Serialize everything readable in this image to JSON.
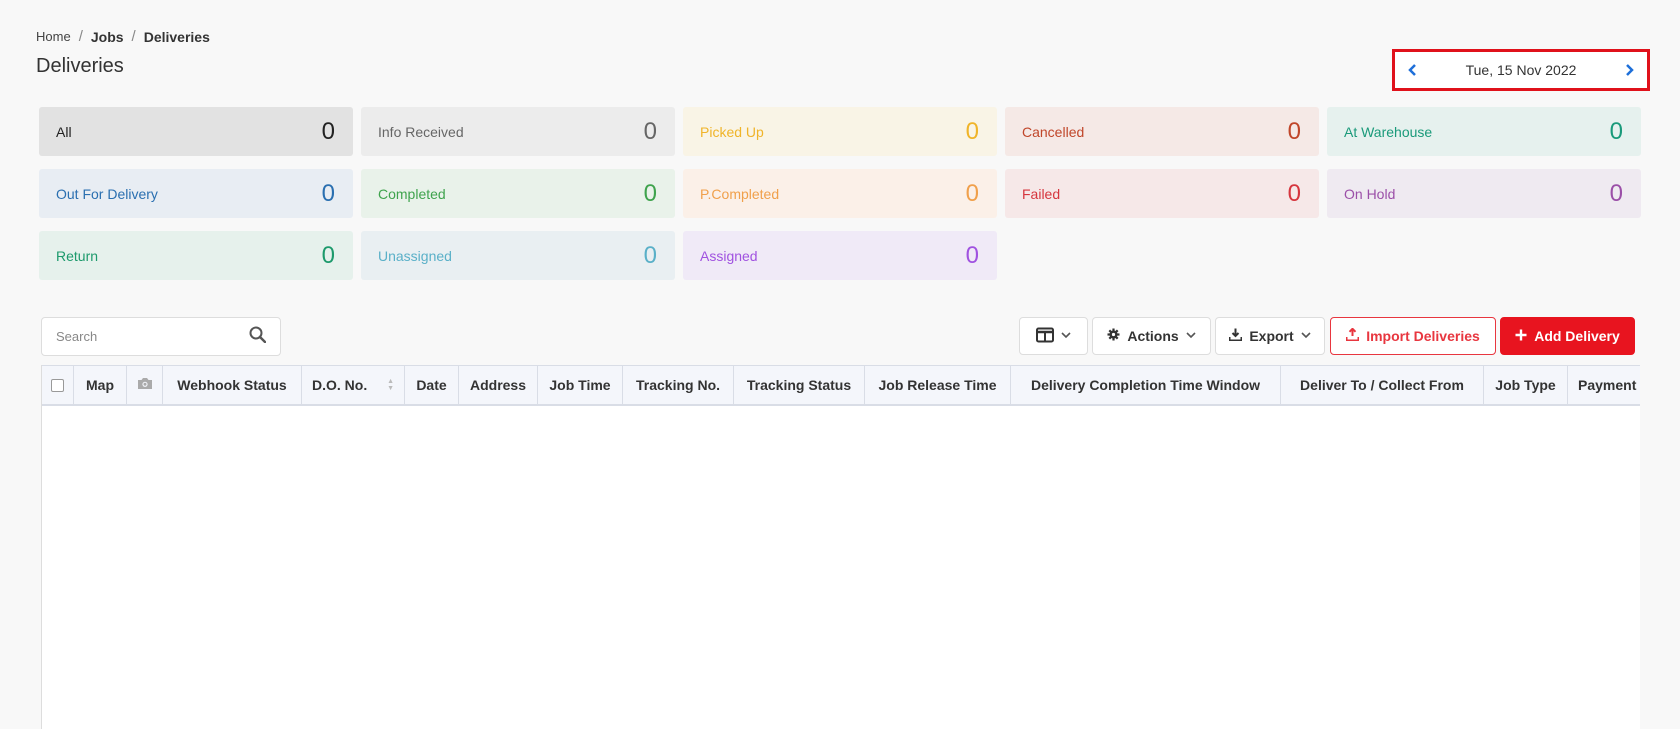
{
  "breadcrumb": {
    "home": "Home",
    "jobs": "Jobs",
    "current": "Deliveries"
  },
  "page": {
    "title": "Deliveries"
  },
  "date_nav": {
    "date": "Tue, 15 Nov 2022",
    "prev": "‹",
    "next": "›"
  },
  "statuses": [
    {
      "label": "All",
      "count": "0",
      "bg": "#e2e2e2",
      "color": "#222"
    },
    {
      "label": "Info Received",
      "count": "0",
      "bg": "#ececec",
      "color": "#666"
    },
    {
      "label": "Picked Up",
      "count": "0",
      "bg": "#f9f4e6",
      "color": "#f0b429"
    },
    {
      "label": "Cancelled",
      "count": "0",
      "bg": "#f5e9e6",
      "color": "#c0462a"
    },
    {
      "label": "At Warehouse",
      "count": "0",
      "bg": "#e6f1ee",
      "color": "#1a9a7a"
    },
    {
      "label": "Out For Delivery",
      "count": "0",
      "bg": "#e8edf3",
      "color": "#2a6fb0"
    },
    {
      "label": "Completed",
      "count": "0",
      "bg": "#e9f2ea",
      "color": "#3fa34d"
    },
    {
      "label": "P.Completed",
      "count": "0",
      "bg": "#fbf0e8",
      "color": "#f0a04b"
    },
    {
      "label": "Failed",
      "count": "0",
      "bg": "#f6e8e8",
      "color": "#d6363e"
    },
    {
      "label": "On Hold",
      "count": "0",
      "bg": "#efeaf1",
      "color": "#9b4fa8"
    },
    {
      "label": "Return",
      "count": "0",
      "bg": "#e6f1ec",
      "color": "#1d9a6c"
    },
    {
      "label": "Unassigned",
      "count": "0",
      "bg": "#e9eff2",
      "color": "#5ab0c8"
    },
    {
      "label": "Assigned",
      "count": "0",
      "bg": "#f0eaf7",
      "color": "#a052e0"
    }
  ],
  "search": {
    "placeholder": "Search"
  },
  "toolbar": {
    "actions": "Actions",
    "export": "Export",
    "import": "Import Deliveries",
    "add": "Add Delivery"
  },
  "table": {
    "columns": [
      "Map",
      "",
      "Webhook Status",
      "D.O. No.",
      "Date",
      "Address",
      "Job Time",
      "Tracking No.",
      "Tracking Status",
      "Job Release Time",
      "Delivery Completion Time Window",
      "Deliver To / Collect From",
      "Job Type",
      "Payment"
    ]
  }
}
